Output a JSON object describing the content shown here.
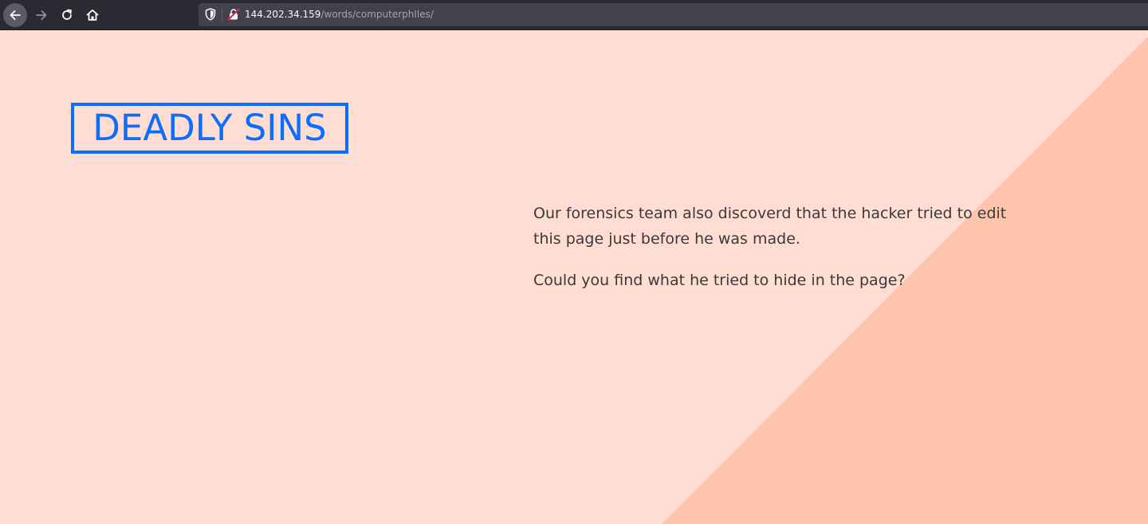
{
  "browser": {
    "nav_icons": {
      "back": "arrow-left-icon",
      "forward": "arrow-right-icon",
      "reload": "reload-icon",
      "home": "home-icon",
      "tracking": "shield-icon",
      "connection": "insecure-lock-icon"
    },
    "url": {
      "host": "144.202.34.159",
      "path": "/words/computerphIles/"
    },
    "colors": {
      "toolbar": "#2b2a33",
      "url_bar": "#42414d"
    }
  },
  "page": {
    "title": "DEADLY SINS",
    "paragraphs": [
      "Our forensics team also discoverd that the hacker tried to edit this page just before he was made.",
      "Could you find what he tried to hide in the page?"
    ],
    "colors": {
      "background": "#ffddd2",
      "accent_triangle": "#ffc4ae",
      "title": "#0d6efd",
      "text": "#3a3a3a"
    }
  }
}
